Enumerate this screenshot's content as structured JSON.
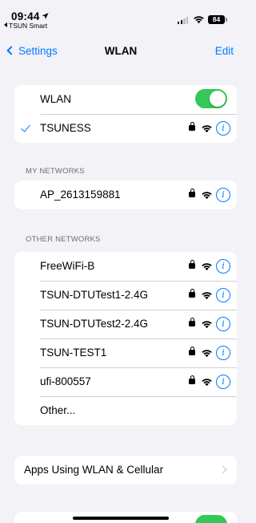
{
  "status_bar": {
    "time": "09:44",
    "back_app": "TSUN Smart",
    "battery": "84"
  },
  "nav": {
    "back_label": "Settings",
    "title": "WLAN",
    "edit_label": "Edit"
  },
  "wlan": {
    "toggle_label": "WLAN",
    "toggle_on": true,
    "connected_network": "TSUNESS"
  },
  "my_networks": {
    "header": "MY NETWORKS",
    "items": [
      {
        "name": "AP_2613159881"
      }
    ]
  },
  "other_networks": {
    "header": "OTHER NETWORKS",
    "items": [
      {
        "name": "FreeWiFi-B"
      },
      {
        "name": "TSUN-DTUTest1-2.4G"
      },
      {
        "name": "TSUN-DTUTest2-2.4G"
      },
      {
        "name": "TSUN-TEST1"
      },
      {
        "name": "ufi-800557"
      }
    ],
    "other_label": "Other..."
  },
  "apps_using": {
    "label": "Apps Using WLAN & Cellular"
  },
  "icons": {
    "back": "chevron-left-icon",
    "checkmark": "checkmark-icon",
    "lock": "lock-icon",
    "wifi": "wifi-icon",
    "info": "info-icon",
    "disclosure": "chevron-right-icon"
  },
  "colors": {
    "accent": "#007aff",
    "toggle_on": "#34c759",
    "background": "#f2f2f7"
  }
}
